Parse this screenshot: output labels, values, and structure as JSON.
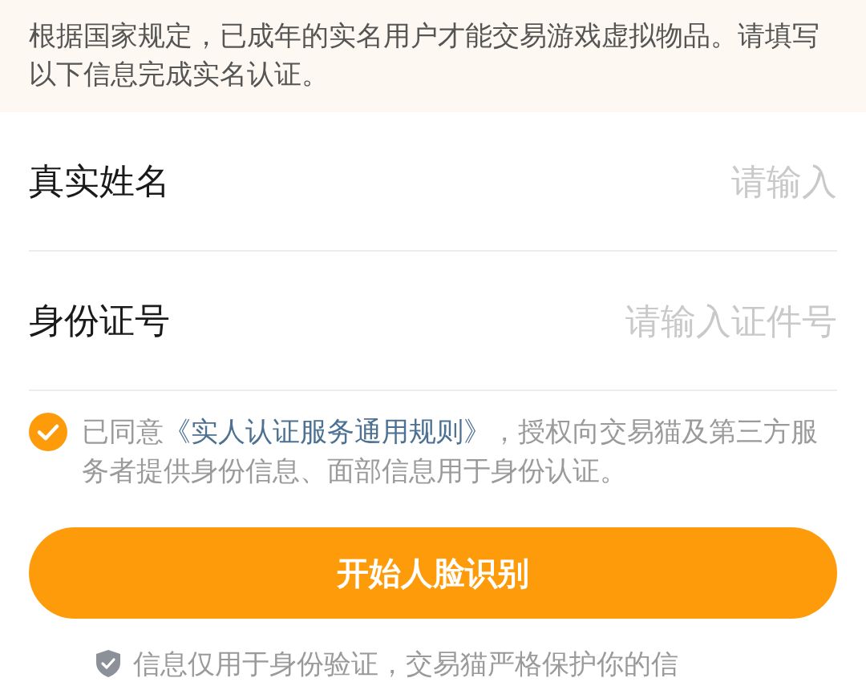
{
  "notice": {
    "text": "根据国家规定，已成年的实名用户才能交易游戏虚拟物品。请填写以下信息完成实名认证。"
  },
  "fields": [
    {
      "label": "真实姓名",
      "placeholder": "请输入"
    },
    {
      "label": "身份证号",
      "placeholder": "请输入证件号"
    }
  ],
  "agreement": {
    "checked": true,
    "prefix": "已同意",
    "link": "《实人认证服务通用规则》",
    "suffix": "，授权向交易猫及第三方服务者提供身份信息、面部信息用于身份认证。"
  },
  "submit_button": {
    "label": "开始人脸识别"
  },
  "footer_note": {
    "text": "信息仅用于身份验证，交易猫严格保护你的信"
  }
}
